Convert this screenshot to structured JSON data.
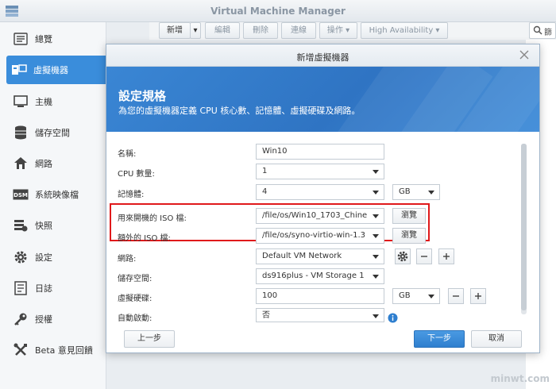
{
  "app": {
    "title": "Virtual Machine Manager"
  },
  "toolbar": {
    "new_label": "新增",
    "edit_label": "編輯",
    "delete_label": "刪除",
    "connect_label": "連線",
    "action_label": "操作 ▾",
    "ha_label": "High Availability ▾",
    "search_text": "篩"
  },
  "sidebar": {
    "items": [
      {
        "label": "總覽",
        "icon": "list-icon"
      },
      {
        "label": "虛擬機器",
        "icon": "virtual-machine-icon"
      },
      {
        "label": "主機",
        "icon": "monitor-icon"
      },
      {
        "label": "儲存空間",
        "icon": "database-icon"
      },
      {
        "label": "網路",
        "icon": "network-icon"
      },
      {
        "label": "系統映像檔",
        "icon": "dsm-image-icon"
      },
      {
        "label": "快照",
        "icon": "snapshot-icon"
      },
      {
        "label": "設定",
        "icon": "gear-icon"
      },
      {
        "label": "日誌",
        "icon": "log-icon"
      },
      {
        "label": "授權",
        "icon": "key-icon"
      },
      {
        "label": "Beta 意見回饋",
        "icon": "tools-icon"
      }
    ],
    "active_index": 1
  },
  "dialog": {
    "title": "新增虛擬機器",
    "banner_title": "設定規格",
    "banner_subtitle": "為您的虛擬機器定義 CPU 核心數、記憶體、虛擬硬碟及網路。",
    "fields": {
      "name": {
        "label": "名稱:",
        "value": "Win10"
      },
      "cpu": {
        "label": "CPU 數量:",
        "value": "1"
      },
      "memory": {
        "label": "記憶體:",
        "value": "4",
        "unit": "GB"
      },
      "boot_iso": {
        "label": "用來開機的 ISO 檔:",
        "value": "/file/os/Win10_1703_Chine",
        "browse": "瀏覽"
      },
      "extra_iso": {
        "label": "額外的 ISO 檔:",
        "value": "/file/os/syno-virtio-win-1.3",
        "browse": "瀏覽"
      },
      "network": {
        "label": "網路:",
        "value": "Default VM Network"
      },
      "storage": {
        "label": "儲存空間:",
        "value": "ds916plus - VM Storage 1"
      },
      "disk": {
        "label": "虛擬硬碟:",
        "value": "100",
        "unit": "GB"
      },
      "autostart": {
        "label": "自動啟動:",
        "value": "否"
      }
    },
    "buttons": {
      "back": "上一步",
      "next": "下一步",
      "cancel": "取消"
    }
  },
  "watermark": "minwt.com",
  "colors": {
    "accent": "#3a8ddb",
    "highlight": "#e0191b",
    "banner": "#2f74c3"
  }
}
